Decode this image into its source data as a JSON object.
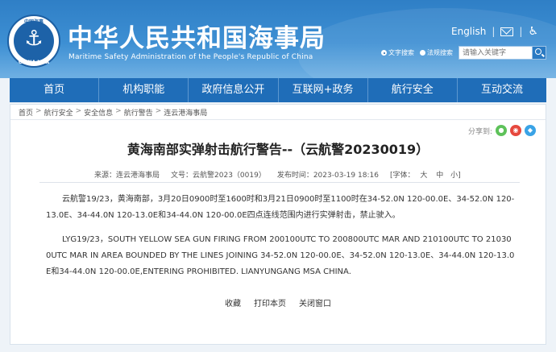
{
  "header": {
    "title": "中华人民共和国海事局",
    "subtitle": "Maritime Safety Administration of the People's Republic of China",
    "emblem_top_text": "中国海事",
    "emblem_bottom_text": "CHINA MSA",
    "english_link": "English",
    "mail_icon": "mail-icon",
    "accessibility_icon": "accessibility-icon",
    "search": {
      "option_text": "文字搜索",
      "option_regulation": "法规搜索",
      "placeholder": "请输入关键字",
      "button_icon": "search-icon"
    }
  },
  "nav": {
    "items": [
      "首页",
      "机构职能",
      "政府信息公开",
      "互联网+政务",
      "航行安全",
      "互动交流"
    ]
  },
  "breadcrumb": [
    "首页",
    "航行安全",
    "安全信息",
    "航行警告",
    "连云港海事局"
  ],
  "share": {
    "label": "分享到:",
    "icons": [
      "wechat-icon",
      "weibo-icon",
      "qq-icon"
    ]
  },
  "article": {
    "title": "黄海南部实弹射击航行警告--（云航警20230019）",
    "source": "来源：连云港海事局",
    "doc_no": "文号：云航警2023（0019）",
    "publish_time": "发布时间：2023-03-19 18:16",
    "font_label": "[字体：",
    "font_large": "大",
    "font_medium": "中",
    "font_small": "小]",
    "para_cn": "云航警19/23，黄海南部，3月20日0900时至1600时和3月21日0900时至1100时在34-52.0N 120-00.0E、34-52.0N 120-13.0E、34-44.0N 120-13.0E和34-44.0N 120-00.0E四点连线范围内进行实弹射击，禁止驶入。",
    "para_en": "LYG19/23，SOUTH YELLOW SEA GUN FIRING FROM 200100UTC TO 200800UTC MAR AND 210100UTC TO 210300UTC MAR IN AREA BOUNDED BY THE LINES JOINING 34-52.0N 120-00.0E、34-52.0N 120-13.0E、34-44.0N 120-13.0E和34-44.0N 120-00.0E,ENTERING PROHIBITED. LIANYUNGANG MSA CHINA."
  },
  "actions": {
    "favorite": "收藏",
    "print": "打印本页",
    "close": "关闭窗口"
  },
  "colors": {
    "header_blue": "#2f7fc6",
    "nav_blue": "#1f6db8",
    "page_bg": "#eef3f8"
  }
}
